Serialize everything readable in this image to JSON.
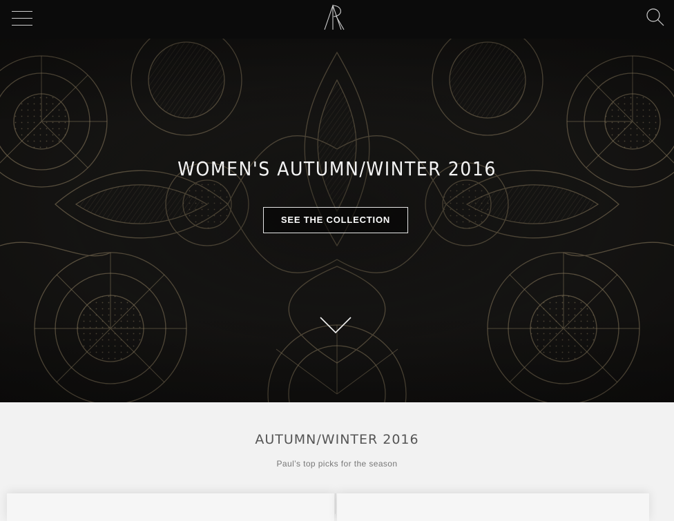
{
  "header": {
    "menu_icon": "hamburger-menu-icon",
    "logo_icon": "paul-smith-monogram-logo",
    "search_icon": "search-icon"
  },
  "hero": {
    "title": "WOMEN'S AUTUMN/WINTER 2016",
    "cta_label": "SEE THE COLLECTION",
    "scroll_icon": "chevron-down-icon",
    "pattern_color": "#9c8a6a",
    "background_color": "#141312"
  },
  "section": {
    "title": "AUTUMN/WINTER 2016",
    "subtitle": "Paul’s top picks for the season"
  }
}
